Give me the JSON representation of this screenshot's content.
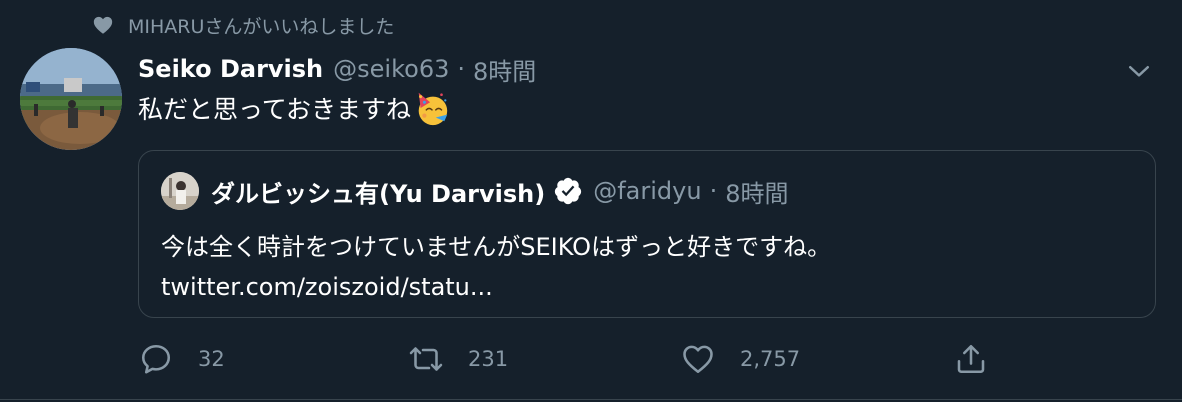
{
  "social_context": {
    "text": "MIHARUさんがいいねしました"
  },
  "tweet": {
    "author_name": "Seiko Darvish",
    "author_handle": "@seiko63",
    "separator": "·",
    "time": "8時間",
    "text": "私だと思っておきますね",
    "emoji": "partying-face"
  },
  "quote": {
    "author_name": "ダルビッシュ有(Yu Darvish)",
    "verified": true,
    "author_handle": "@faridyu",
    "separator": "·",
    "time": "8時間",
    "text_line1": "今は全く時計をつけていませんがSEIKOはずっと好きですね。",
    "text_line2": "twitter.com/zoiszoid/statu..."
  },
  "actions": {
    "reply_count": "32",
    "retweet_count": "231",
    "like_count": "2,757"
  },
  "colors": {
    "background": "#15202b",
    "secondary_text": "#8899a6",
    "border": "#38444d",
    "verified_badge": "#ffffff"
  }
}
